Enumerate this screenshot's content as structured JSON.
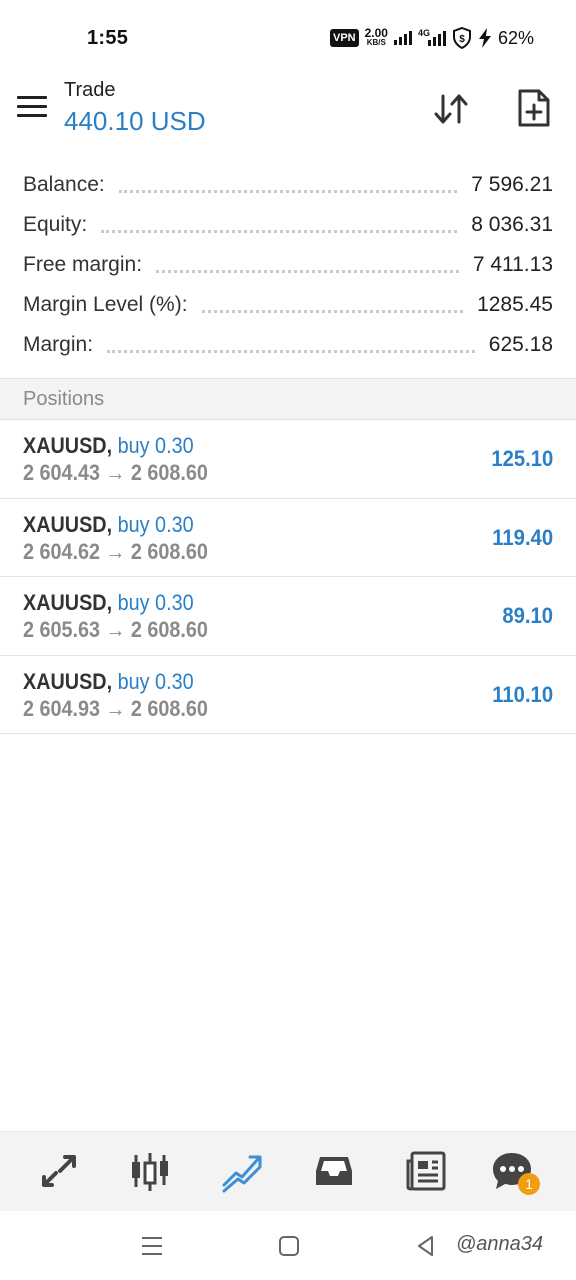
{
  "status_bar": {
    "time": "1:55",
    "vpn": "VPN",
    "speed_value": "2.00",
    "speed_unit": "KB/S",
    "network": "4G",
    "battery": "62%"
  },
  "header": {
    "title": "Trade",
    "amount": "440.10 USD",
    "icons": [
      "menu-icon",
      "sort-icon",
      "new-order-icon"
    ]
  },
  "account": [
    {
      "label": "Balance:",
      "value": "7 596.21"
    },
    {
      "label": "Equity:",
      "value": "8 036.31"
    },
    {
      "label": "Free margin:",
      "value": "7 411.13"
    },
    {
      "label": "Margin Level (%):",
      "value": "1285.45"
    },
    {
      "label": "Margin:",
      "value": "625.18"
    }
  ],
  "positions": {
    "title": "Positions",
    "items": [
      {
        "symbol": "XAUUSD,",
        "side": "buy 0.30",
        "prices": "2 604.43 → 2 608.60",
        "profit": "125.10"
      },
      {
        "symbol": "XAUUSD,",
        "side": "buy 0.30",
        "prices": "2 604.62 → 2 608.60",
        "profit": "119.40"
      },
      {
        "symbol": "XAUUSD,",
        "side": "buy 0.30",
        "prices": "2 605.63 → 2 608.60",
        "profit": "89.10"
      },
      {
        "symbol": "XAUUSD,",
        "side": "buy 0.30",
        "prices": "2 604.93 → 2 608.60",
        "profit": "110.10"
      }
    ]
  },
  "bottom_nav": {
    "items": [
      "quotes-icon",
      "chart-icon",
      "trade-icon",
      "history-icon",
      "news-icon",
      "chat-icon"
    ],
    "active": "trade-icon",
    "chat_badge": "1"
  },
  "colors": {
    "accent": "#2a7fc6",
    "badge": "#f39c12"
  },
  "watermark": "@anna34"
}
